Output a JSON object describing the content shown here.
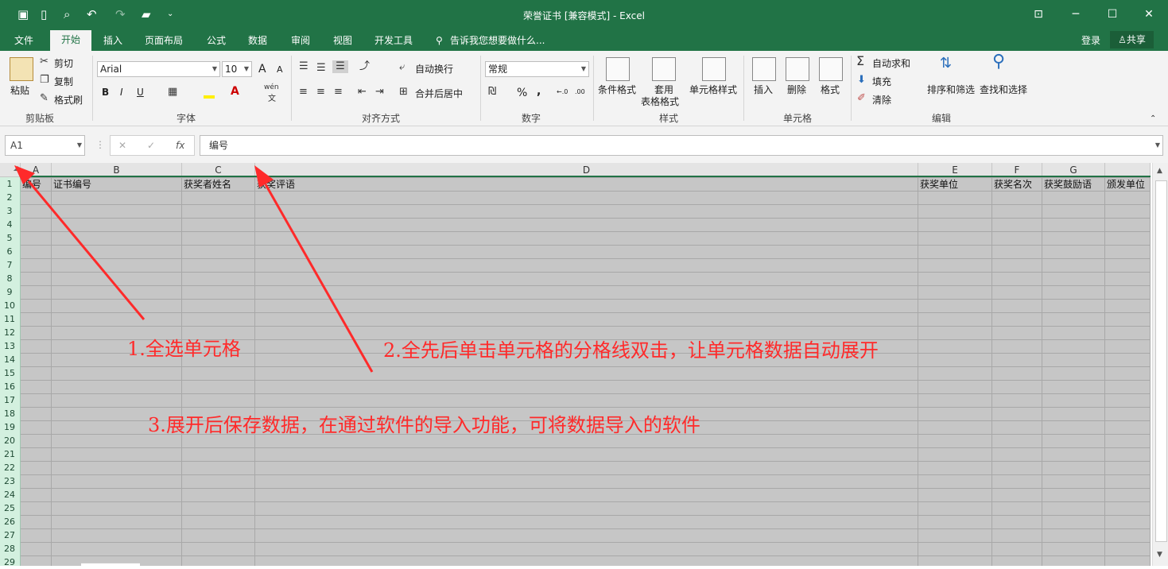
{
  "window": {
    "title": "荣誉证书  [兼容模式] - Excel"
  },
  "quick_access": {
    "dropdown_glyph": "⌄"
  },
  "window_controls": {
    "ribbon_display": "⊡",
    "minimize": "─",
    "maximize": "☐",
    "close": "✕"
  },
  "tabs": [
    "文件",
    "开始",
    "插入",
    "页面布局",
    "公式",
    "数据",
    "审阅",
    "视图",
    "开发工具"
  ],
  "tell_me": "告诉我您想要做什么...",
  "account": {
    "login": "登录",
    "share": "共享"
  },
  "ribbon": {
    "clipboard": {
      "paste": "粘贴",
      "cut": "剪切",
      "copy": "复制",
      "format_painter": "格式刷",
      "group": "剪贴板"
    },
    "font": {
      "name": "Arial",
      "size": "10",
      "bold": "B",
      "italic": "I",
      "underline": "U",
      "font_color_glyph": "A",
      "grow": "A",
      "shrink": "A",
      "phonetic": "wén",
      "phonetic_char": "文",
      "group": "字体"
    },
    "alignment": {
      "wrap": "自动换行",
      "merge": "合并后居中",
      "group": "对齐方式"
    },
    "number": {
      "format": "常规",
      "percent": "%",
      "comma": ",",
      "inc_decimal": "←.0",
      "dec_decimal": ".00",
      "group": "数字"
    },
    "styles": {
      "conditional": "条件格式",
      "table_1": "套用",
      "table_2": "表格格式",
      "cell_styles": "单元格样式",
      "group": "样式"
    },
    "cells": {
      "insert": "插入",
      "delete": "删除",
      "format": "格式",
      "group": "单元格"
    },
    "editing": {
      "autosum": "自动求和",
      "fill": "填充",
      "clear": "清除",
      "sort": "排序和筛选",
      "find": "查找和选择",
      "group": "编辑"
    }
  },
  "formula_bar": {
    "name_box": "A1",
    "cancel": "✕",
    "enter": "✓",
    "fx": "fx",
    "content": "编号"
  },
  "columns": [
    "A",
    "B",
    "C",
    "D",
    "E",
    "F",
    "G"
  ],
  "rows": [
    "1",
    "2",
    "3",
    "4",
    "5",
    "6",
    "7",
    "8",
    "9",
    "10",
    "11",
    "12",
    "13",
    "14",
    "15",
    "16",
    "17",
    "18",
    "19",
    "20",
    "21",
    "22",
    "23",
    "24",
    "25",
    "26",
    "27",
    "28",
    "29"
  ],
  "header_row": [
    "编号",
    "证书编号",
    "获奖者姓名",
    "获奖评语",
    "获奖单位",
    "获奖名次",
    "获奖鼓励语",
    "颁发单位"
  ],
  "annotations": [
    "1.全选单元格",
    "2.全先后单击单元格的分格线双击，让单元格数据自动展开",
    "3.展开后保存数据，在通过软件的导入功能，可将数据导入的软件"
  ],
  "colors": {
    "excel_green": "#217346",
    "annotation_red": "#ff2a2a",
    "selection_gray": "#c6c6c6"
  }
}
